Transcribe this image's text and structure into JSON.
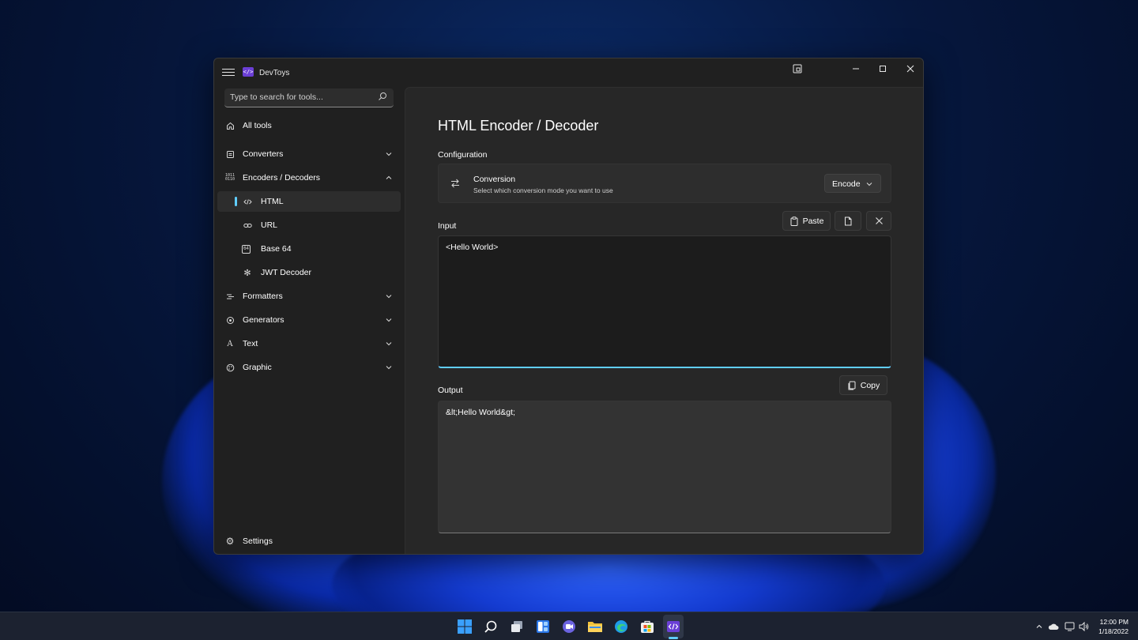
{
  "app": {
    "title": "DevToys",
    "icon_text": "</>"
  },
  "search": {
    "placeholder": "Type to search for tools..."
  },
  "nav": {
    "all_tools": "All tools",
    "converters": "Converters",
    "encoders_decoders": "Encoders / Decoders",
    "html": "HTML",
    "url": "URL",
    "base64": "Base 64",
    "jwt": "JWT Decoder",
    "formatters": "Formatters",
    "generators": "Generators",
    "text": "Text",
    "graphic": "Graphic",
    "settings": "Settings",
    "encoders_icon_text": "1011\n0110",
    "base64_icon_text": "64",
    "text_icon_text": "A"
  },
  "page": {
    "title": "HTML Encoder / Decoder",
    "configuration_label": "Configuration",
    "conversion_title": "Conversion",
    "conversion_subtitle": "Select which conversion mode you want to use",
    "conversion_value": "Encode",
    "input_label": "Input",
    "input_value": "<Hello World>",
    "paste_label": "Paste",
    "output_label": "Output",
    "output_value": "&lt;Hello World&gt;",
    "copy_label": "Copy"
  },
  "taskbar": {
    "time": "12:00 PM",
    "date": "1/18/2022",
    "apps": [
      "start-icon",
      "search-icon",
      "task-view-icon",
      "widgets-icon",
      "chat-icon",
      "file-explorer-icon",
      "edge-icon",
      "store-icon",
      "devtoys-icon"
    ]
  },
  "colors": {
    "accent": "#60cdff",
    "window_bg": "#202020",
    "content_bg": "#272727",
    "app_icon": "#6b3fd6"
  }
}
